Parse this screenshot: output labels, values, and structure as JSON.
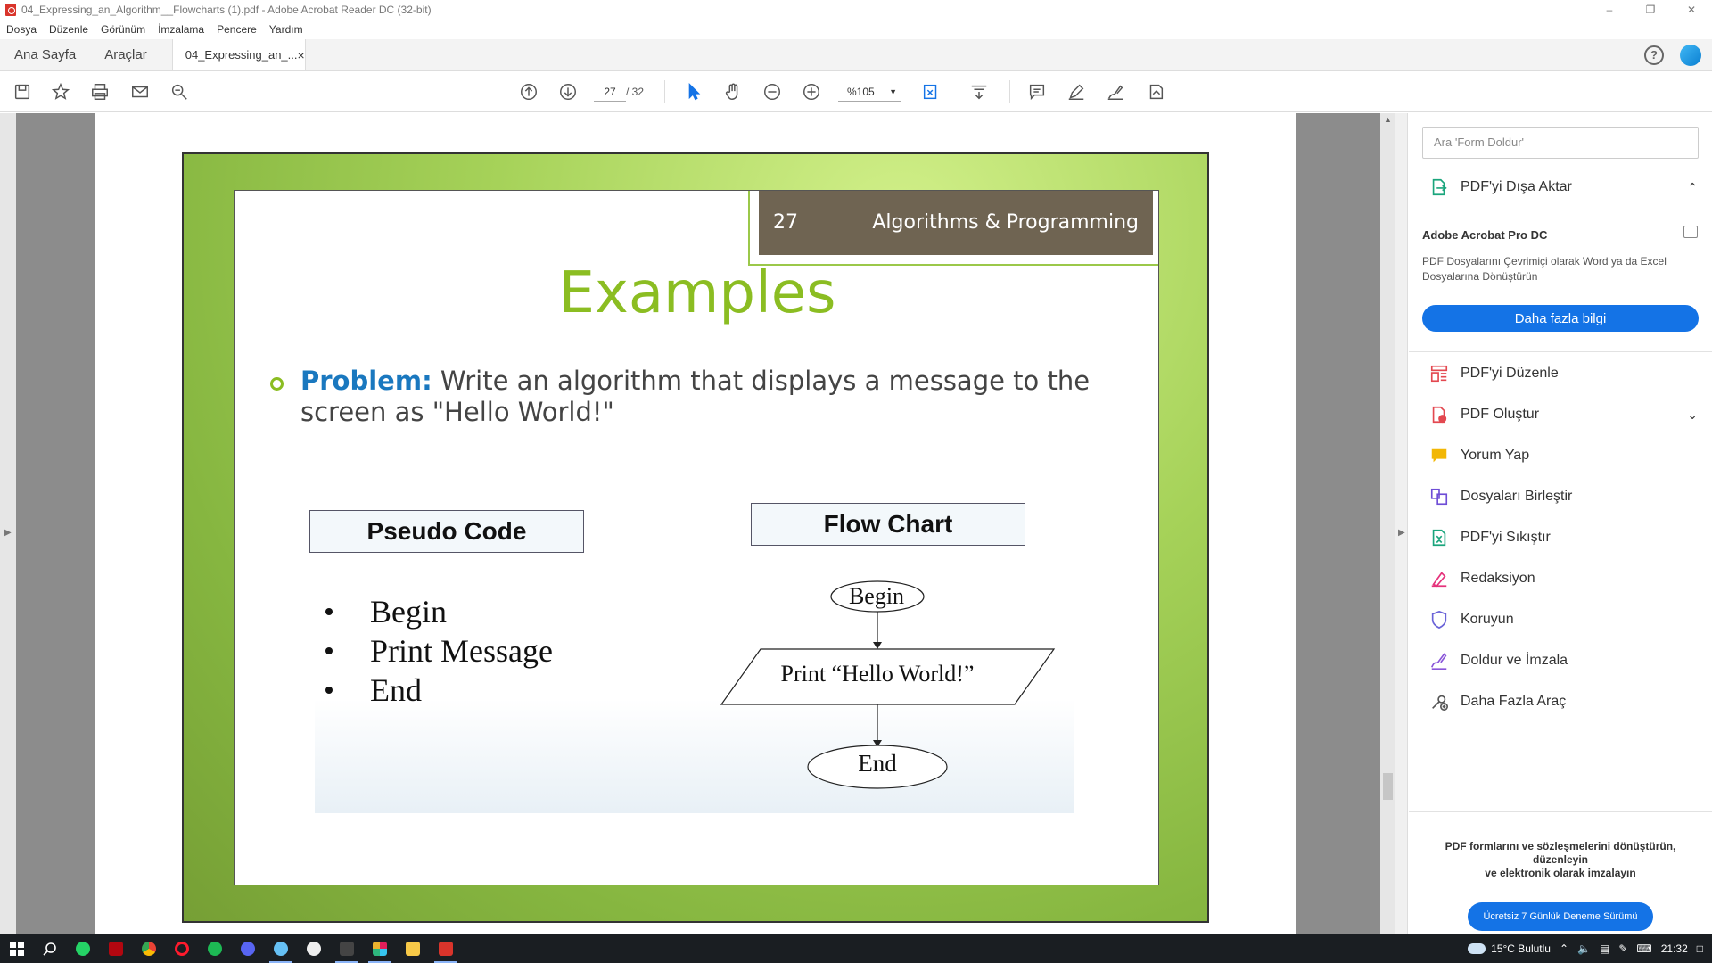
{
  "window": {
    "title": "04_Expressing_an_Algorithm__Flowcharts (1).pdf - Adobe Acrobat Reader DC (32-bit)"
  },
  "menu": [
    "Dosya",
    "Düzenle",
    "Görünüm",
    "İmzalama",
    "Pencere",
    "Yardım"
  ],
  "tabs": {
    "home": "Ana Sayfa",
    "tools": "Araçlar",
    "document": "04_Expressing_an_...",
    "close": "×"
  },
  "toolbar": {
    "page_current": "27",
    "page_total": "/ 32",
    "zoom": "%105"
  },
  "slide": {
    "number": "27",
    "course": "Algorithms & Programming",
    "title": "Examples",
    "problem_keyword": "Problem:",
    "problem_text": " Write an algorithm that displays a message to the screen as \"Hello World!\"",
    "pseudo_label": "Pseudo Code",
    "flow_label": "Flow Chart",
    "pseudo_items": [
      "Begin",
      "Print Message",
      "End"
    ],
    "flow": {
      "begin": "Begin",
      "print": "Print “Hello World!”",
      "end": "End"
    }
  },
  "right_panel": {
    "search_placeholder": "Ara 'Form Doldur'",
    "export_pdf": "PDF'yi Dışa Aktar",
    "pro_title": "Adobe Acrobat Pro DC",
    "pro_desc": "PDF Dosyalarını Çevrimiçi olarak Word ya da Excel Dosyalarına Dönüştürün",
    "learn_more": "Daha fazla bilgi",
    "tools": [
      {
        "label": "PDF'yi Düzenle",
        "icon": "edit-pdf-icon",
        "color": "#e34850"
      },
      {
        "label": "PDF Oluştur",
        "icon": "create-pdf-icon",
        "color": "#e34850"
      },
      {
        "label": "Yorum Yap",
        "icon": "comment-icon",
        "color": "#f2b705"
      },
      {
        "label": "Dosyaları Birleştir",
        "icon": "combine-files-icon",
        "color": "#6e4dd6"
      },
      {
        "label": "PDF'yi Sıkıştır",
        "icon": "compress-pdf-icon",
        "color": "#1aa57c"
      },
      {
        "label": "Redaksiyon",
        "icon": "redact-icon",
        "color": "#e5327b"
      },
      {
        "label": "Koruyun",
        "icon": "protect-icon",
        "color": "#6a63d8"
      },
      {
        "label": "Doldur ve İmzala",
        "icon": "fill-sign-icon",
        "color": "#8a55d9"
      },
      {
        "label": "Daha Fazla Araç",
        "icon": "more-tools-icon",
        "color": "#555555"
      }
    ],
    "footer_text_1": "PDF formlarını ve sözleşmelerini dönüştürün, düzenleyin",
    "footer_text_2": "ve elektronik olarak imzalayın",
    "trial_button": "Ücretsiz 7 Günlük Deneme Sürümü"
  },
  "taskbar": {
    "weather": "15°C  Bulutlu",
    "time": "21:32"
  },
  "colors": {
    "accent_blue": "#1473e6",
    "slide_green": "#8bbd22",
    "header_brown": "#6f6452"
  }
}
